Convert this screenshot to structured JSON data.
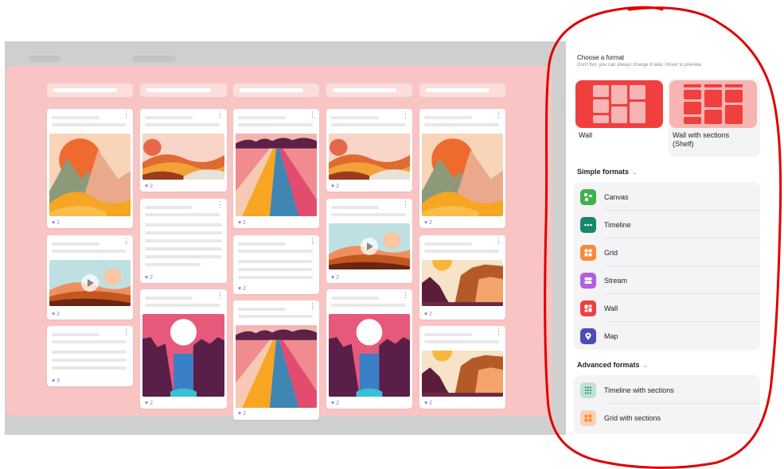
{
  "board": {
    "like_count": "2",
    "like_count_3": "3"
  },
  "panel": {
    "title": "Choose a format",
    "subtitle": "Don't fret, you can always change it later. Hover to preview.",
    "featured": [
      {
        "label": "Wall",
        "icon": "wall-thumbnail"
      },
      {
        "label": "Wall with sections (Shelf)",
        "icon": "shelf-thumbnail"
      }
    ],
    "simple_heading": "Simple formats",
    "simple_items": [
      {
        "label": "Canvas",
        "icon": "canvas-icon",
        "color": "#3db34a"
      },
      {
        "label": "Timeline",
        "icon": "timeline-icon",
        "color": "#17866a"
      },
      {
        "label": "Grid",
        "icon": "grid-icon",
        "color": "#f98a3d"
      },
      {
        "label": "Stream",
        "icon": "stream-icon",
        "color": "#b160e0"
      },
      {
        "label": "Wall",
        "icon": "wall-icon",
        "color": "#ef3f3f"
      },
      {
        "label": "Map",
        "icon": "map-icon",
        "color": "#4b4fb5"
      }
    ],
    "advanced_heading": "Advanced formats",
    "advanced_items": [
      {
        "label": "Timeline with sections",
        "icon": "timeline-sections-icon",
        "color": "#bfe3d2"
      },
      {
        "label": "Grid with sections",
        "icon": "grid-sections-icon",
        "color": "#fcd1b3"
      }
    ]
  },
  "colors": {
    "board_bg": "#f9c5c4",
    "accent_red": "#ef3f3f",
    "annotation": "#e00000"
  }
}
